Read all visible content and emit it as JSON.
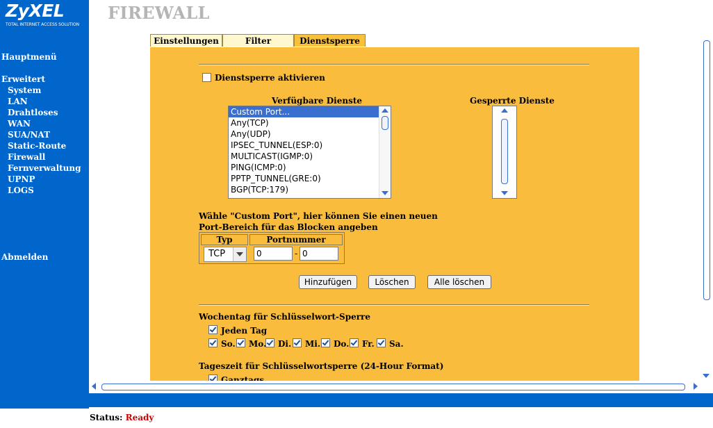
{
  "brand": {
    "logo": "ZyXEL",
    "tagline": "TOTAL INTERNET ACCESS SOLUTION"
  },
  "nav": {
    "main_menu": "Hauptmenü",
    "advanced": "Erweitert",
    "items": [
      "System",
      "LAN",
      "Drahtloses",
      "WAN",
      "SUA/NAT",
      "Static-Route",
      "Firewall",
      "Fernverwaltung",
      "UPNP",
      "LOGS"
    ],
    "logout": "Abmelden"
  },
  "page": {
    "title": "FIREWALL"
  },
  "tabs": [
    {
      "label": "Einstellungen"
    },
    {
      "label": "Filter"
    },
    {
      "label": "Dienstsperre",
      "active": true
    }
  ],
  "service_block": {
    "enable_label": "Dienstsperre aktivieren",
    "enabled": false,
    "available_title": "Verfügbare Dienste",
    "blocked_title": "Gesperrte Dienste",
    "available": [
      "Custom Port...",
      "Any(TCP)",
      "Any(UDP)",
      "IPSEC_TUNNEL(ESP:0)",
      "MULTICAST(IGMP:0)",
      "PING(ICMP:0)",
      "PPTP_TUNNEL(GRE:0)",
      "BGP(TCP:179)"
    ],
    "selected_available": "Custom Port...",
    "blocked": []
  },
  "custom_port": {
    "hint_line1": "Wähle \"Custom Port\", hier können Sie einen neuen",
    "hint_line2": "Port-Bereich für das Blocken angeben",
    "col_type": "Typ",
    "col_port": "Portnummer",
    "type_value": "TCP",
    "port_from": "0",
    "port_sep": "-",
    "port_to": "0"
  },
  "buttons": {
    "add": "Hinzufügen",
    "delete": "Löschen",
    "delete_all": "Alle löschen"
  },
  "schedule": {
    "weekday_title": "Wochentag für Schlüsselwort-Sperre",
    "every_day_label": "Jeden Tag",
    "days": [
      {
        "label": "So.",
        "checked": true
      },
      {
        "label": "Mo.",
        "checked": true
      },
      {
        "label": "Di.",
        "checked": true
      },
      {
        "label": "Mi.",
        "checked": true
      },
      {
        "label": "Do.",
        "checked": true
      },
      {
        "label": "Fr.",
        "checked": true
      },
      {
        "label": "Sa.",
        "checked": true
      }
    ],
    "time_title": "Tageszeit für Schlüsselwortsperre (24-Hour Format)",
    "all_day_label": "Ganztags"
  },
  "status": {
    "label": "Status:",
    "value": "Ready"
  },
  "colors": {
    "sidebar": "#0066cc",
    "panel": "#f9bc3c",
    "tab_inactive": "#fff8cf",
    "status_value": "#cc0000"
  }
}
